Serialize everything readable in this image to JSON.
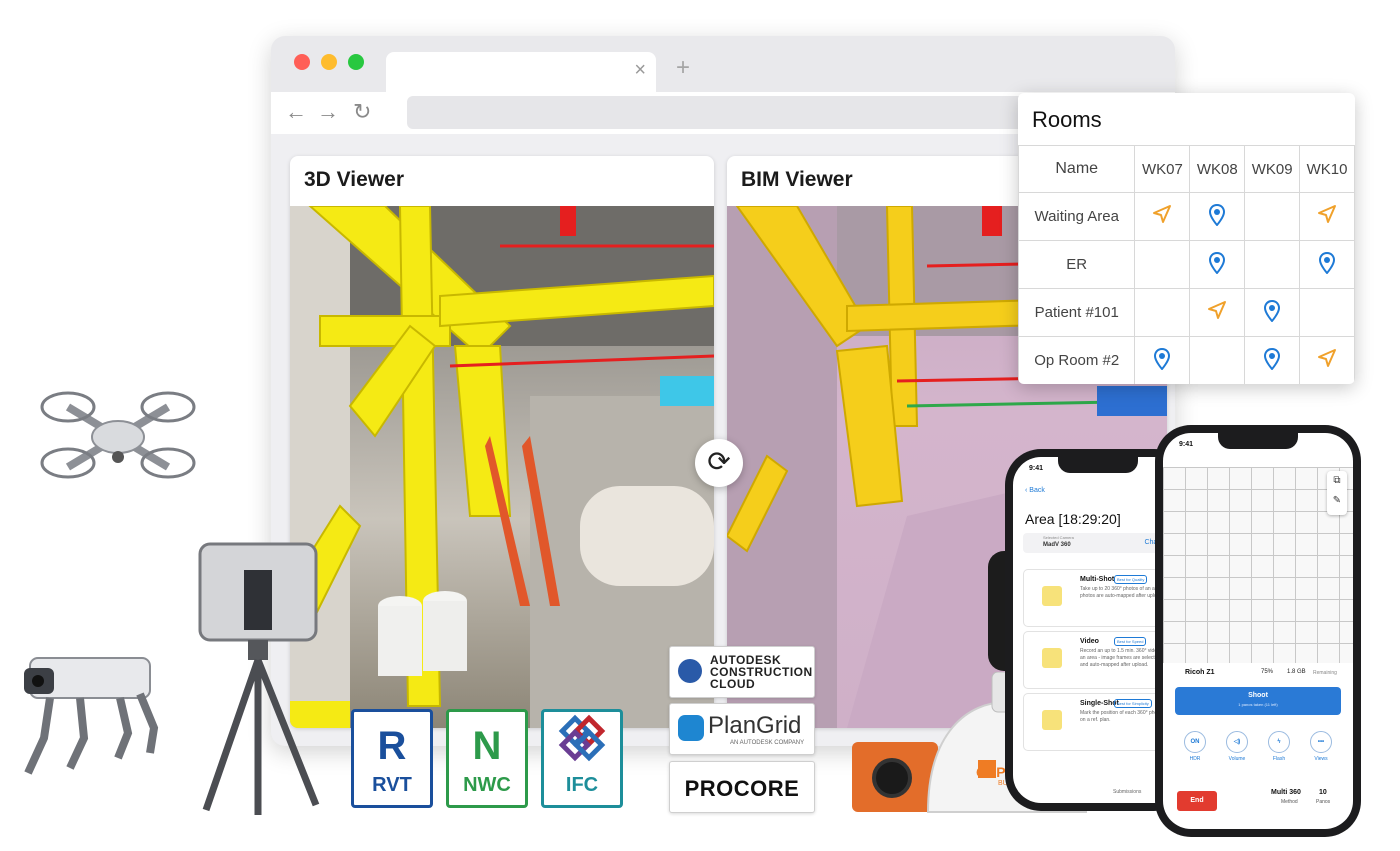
{
  "browser": {
    "tab_close": "×",
    "new_tab": "+",
    "back": "←",
    "forward": "→",
    "reload": "↻"
  },
  "viewers": {
    "left_title": "3D Viewer",
    "right_title": "BIM Viewer",
    "sync_icon": "sync-icon"
  },
  "rooms": {
    "title": "Rooms",
    "columns": [
      "Name",
      "WK07",
      "WK08",
      "WK09",
      "WK10"
    ],
    "rows": [
      {
        "name": "Waiting Area",
        "cells": [
          "arrow",
          "pin",
          "",
          "arrow"
        ]
      },
      {
        "name": "ER",
        "cells": [
          "",
          "pin",
          "",
          "pin"
        ]
      },
      {
        "name": "Patient #101",
        "cells": [
          "",
          "arrow",
          "pin",
          ""
        ]
      },
      {
        "name": "Op Room #2",
        "cells": [
          "pin",
          "",
          "pin",
          "arrow"
        ]
      }
    ]
  },
  "file_formats": {
    "rvt": {
      "letter": "R",
      "ext": "RVT"
    },
    "nwc": {
      "letter": "N",
      "ext": "NWC"
    },
    "ifc": {
      "ext": "IFC"
    }
  },
  "integrations": {
    "acc_line1": "AUTODESK",
    "acc_line2": "CONSTRUCTION",
    "acc_line3": "CLOUD",
    "plangrid": "PlanGrid",
    "plangrid_sub": "AN AUTODESK COMPANY",
    "procore": "PROCORE"
  },
  "helmet": {
    "brand": "CUPIX",
    "tagline": "BUILD SMART"
  },
  "phone_left": {
    "time": "9:41",
    "back": "‹ Back",
    "area_title": "Area [18:29:20]",
    "camera_label": "Selected Camera",
    "camera_value": "MadV 360",
    "change": "Change",
    "modes": [
      {
        "name": "Multi-Shot",
        "tag": "Best for Quality",
        "desc": "Take up to 20 360° photos of an area - photos are auto-mapped after upload."
      },
      {
        "name": "Video",
        "tag": "Best for Speed",
        "desc": "Record an up to 1.5 min. 360° video of an area - image frames are selected and auto-mapped after upload."
      },
      {
        "name": "Single-Shot",
        "tag": "Best for Simplicity",
        "desc": "Mark the position of each 360° photo on a ref. plan."
      }
    ],
    "submissions": "Submissions"
  },
  "phone_right": {
    "time": "9:41",
    "camera": "Ricoh Z1",
    "battery": "75%",
    "storage": "1.8 GB",
    "remaining": "Remaining",
    "shoot": "Shoot",
    "shoot_sub": "1 panos taken (11 left)",
    "controls": [
      {
        "icon": "ON",
        "label": "HDR"
      },
      {
        "icon": "◁)",
        "label": "Volume"
      },
      {
        "icon": "ϟ",
        "label": "Flash"
      },
      {
        "icon": "•••",
        "label": "Views"
      }
    ],
    "end": "End",
    "method_value": "Multi 360",
    "method_label": "Method",
    "panos_value": "10",
    "panos_label": "Panos"
  }
}
